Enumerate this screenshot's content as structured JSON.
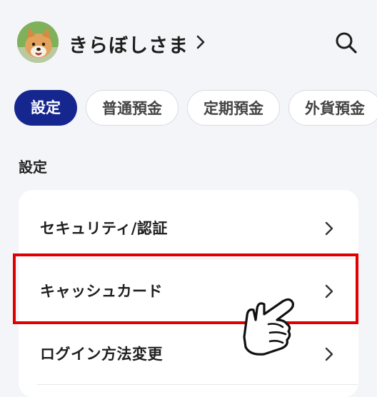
{
  "header": {
    "user_name": "きらぼしさま",
    "avatar_icon": "dog-photo-avatar",
    "search_icon": "search-icon"
  },
  "tabs": [
    {
      "label": "設定",
      "active": true
    },
    {
      "label": "普通預金",
      "active": false
    },
    {
      "label": "定期預金",
      "active": false
    },
    {
      "label": "外貨預金",
      "active": false
    }
  ],
  "section": {
    "title": "設定",
    "items": [
      {
        "label": "セキュリティ/認証"
      },
      {
        "label": "キャッシュカード",
        "highlighted": true
      },
      {
        "label": "ログイン方法変更"
      }
    ]
  },
  "colors": {
    "accent": "#15268f",
    "highlight": "#e00000",
    "background": "#f4f5f8"
  }
}
